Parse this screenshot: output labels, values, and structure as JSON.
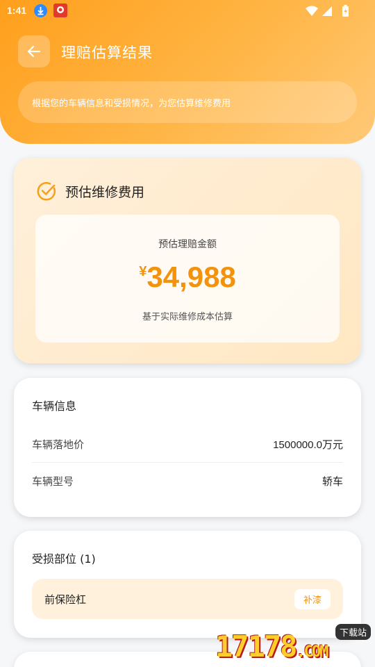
{
  "status_bar": {
    "time": "1:41"
  },
  "header": {
    "title": "理赔估算结果",
    "subtitle": "根据您的车辆信息和受损情况，为您估算维修费用"
  },
  "estimate": {
    "title": "预估维修费用",
    "label": "预估理赔金额",
    "currency": "¥",
    "amount": "34,988",
    "note": "基于实际维修成本估算"
  },
  "vehicle": {
    "title": "车辆信息",
    "rows": [
      {
        "label": "车辆落地价",
        "value": "1500000.0万元"
      },
      {
        "label": "车辆型号",
        "value": "轿车"
      }
    ]
  },
  "damage": {
    "title": "受损部位 (1)",
    "items": [
      {
        "name": "前保险杠",
        "tag": "补漆"
      }
    ]
  },
  "watermark": {
    "text": "17178",
    "suffix": ".COM",
    "tag": "下载站"
  },
  "colors": {
    "accent": "#f3930d",
    "header_start": "#ff9f1c",
    "header_end": "#ffc978"
  }
}
